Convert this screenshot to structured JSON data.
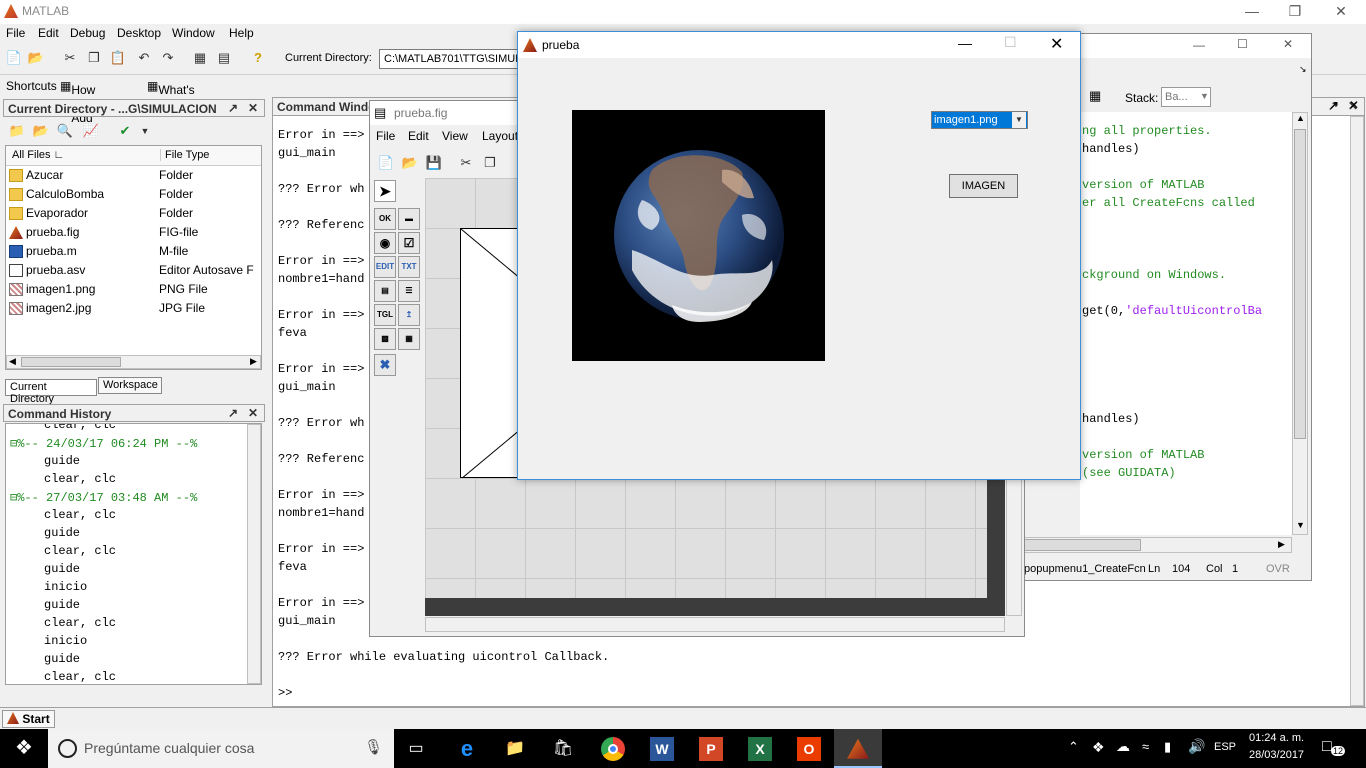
{
  "app": {
    "title": "MATLAB"
  },
  "menu": [
    "File",
    "Edit",
    "Debug",
    "Desktop",
    "Window",
    "Help"
  ],
  "toolbar": {
    "current_dir_label": "Current Directory:",
    "current_dir_value": "C:\\MATLAB701\\TTG\\SIMULA"
  },
  "shortcuts": {
    "label": "Shortcuts",
    "how_to_add": "How to Add",
    "whats_new": "What's New"
  },
  "current_directory": {
    "title": "Current Directory - ...G\\SIMULACION",
    "col_name": "All Files",
    "col_type": "File Type",
    "files": [
      {
        "name": "Azucar",
        "type": "Folder",
        "icon": "folder-icon"
      },
      {
        "name": "CalculoBomba",
        "type": "Folder",
        "icon": "folder-icon"
      },
      {
        "name": "Evaporador",
        "type": "Folder",
        "icon": "folder-icon"
      },
      {
        "name": "prueba.fig",
        "type": "FIG-file",
        "icon": "fig-file-icon"
      },
      {
        "name": "prueba.m",
        "type": "M-file",
        "icon": "m-file-icon"
      },
      {
        "name": "prueba.asv",
        "type": "Editor Autosave F",
        "icon": "file-icon"
      },
      {
        "name": "imagen1.png",
        "type": "PNG File",
        "icon": "image-file-icon"
      },
      {
        "name": "imagen2.jpg",
        "type": "JPG File",
        "icon": "image-file-icon"
      }
    ],
    "tab_cd": "Current Directory",
    "tab_ws": "Workspace"
  },
  "command_history": {
    "title": "Command History",
    "lines": [
      {
        "text": "clear, clc",
        "kind": "cmd"
      },
      {
        "text": "%-- 24/03/17 06:24 PM --%",
        "kind": "session"
      },
      {
        "text": "guide",
        "kind": "cmd"
      },
      {
        "text": "clear, clc",
        "kind": "cmd"
      },
      {
        "text": "%-- 27/03/17 03:48 AM --%",
        "kind": "session"
      },
      {
        "text": "clear, clc",
        "kind": "cmd"
      },
      {
        "text": "guide",
        "kind": "cmd"
      },
      {
        "text": "clear, clc",
        "kind": "cmd"
      },
      {
        "text": "guide",
        "kind": "cmd"
      },
      {
        "text": "inicio",
        "kind": "cmd"
      },
      {
        "text": "guide",
        "kind": "cmd"
      },
      {
        "text": "clear, clc",
        "kind": "cmd"
      },
      {
        "text": "inicio",
        "kind": "cmd"
      },
      {
        "text": "guide",
        "kind": "cmd"
      },
      {
        "text": "clear, clc",
        "kind": "cmd"
      }
    ]
  },
  "command_window": {
    "title": "Command Windo",
    "lines": [
      "Error in ==>",
      "    gui_main",
      "",
      "??? Error wh",
      "",
      "??? Referenc",
      "",
      "Error in ==>",
      "nombre1=hand",
      "",
      "Error in ==>",
      "        feva",
      "",
      "Error in ==>",
      "    gui_main",
      "",
      "??? Error wh",
      "",
      "??? Referenc",
      "",
      "Error in ==>",
      "nombre1=hand",
      "",
      "Error in ==>",
      "        feva",
      "",
      "Error in ==>",
      "    gui_main",
      "",
      "??? Error while evaluating uicontrol Callback.",
      "",
      ">>"
    ]
  },
  "editor": {
    "stack_label": "Stack:",
    "stack_value": "Ba...",
    "code": [
      {
        "text": "ng all properties.",
        "color": "#228b22"
      },
      {
        "text": "handles)",
        "color": "#000000"
      },
      {
        "text": "",
        "color": "#000000"
      },
      {
        "text": "version of MATLAB",
        "color": "#228b22"
      },
      {
        "text": "er all CreateFcns called",
        "color": "#228b22"
      },
      {
        "text": "",
        "color": "#000000"
      },
      {
        "text": "",
        "color": "#000000"
      },
      {
        "text": "",
        "color": "#000000"
      },
      {
        "text": "ckground on Windows.",
        "color": "#228b22"
      },
      {
        "text": "",
        "color": "#000000"
      },
      {
        "text": " get(0,'defaultUicontrolBa",
        "color": "#000000"
      },
      {
        "text": "",
        "color": "#000000"
      },
      {
        "text": "",
        "color": "#000000"
      },
      {
        "text": "",
        "color": "#000000"
      },
      {
        "text": "",
        "color": "#000000"
      },
      {
        "text": "handles)",
        "color": "#000000"
      },
      {
        "text": "",
        "color": "#000000"
      },
      {
        "text": "version of MATLAB",
        "color": "#228b22"
      },
      {
        "text": "(see GUIDATA)",
        "color": "#228b22"
      }
    ],
    "status_fn": "popupmenu1_CreateFcn",
    "ln_label": "Ln",
    "ln_value": "104",
    "col_label": "Col",
    "col_value": "1",
    "ovr": "OVR"
  },
  "guide": {
    "title": "prueba.fig",
    "menu": [
      "File",
      "Edit",
      "View",
      "Layout"
    ],
    "palette": [
      "OK",
      "SLD",
      "RB",
      "CHK",
      "EDIT",
      "TXT",
      "POP",
      "LST",
      "TGL",
      "AX",
      "PNL",
      "BTN",
      "ACT"
    ]
  },
  "figure": {
    "title": "prueba",
    "popup_value": "imagen1.png",
    "button_label": "IMAGEN"
  },
  "statusbar": {
    "start": "Start"
  },
  "taskbar": {
    "search_placeholder": "Pregúntame cualquier cosa",
    "language": "ESP",
    "time": "01:24 a. m.",
    "date": "28/03/2017",
    "notifications": "12"
  }
}
